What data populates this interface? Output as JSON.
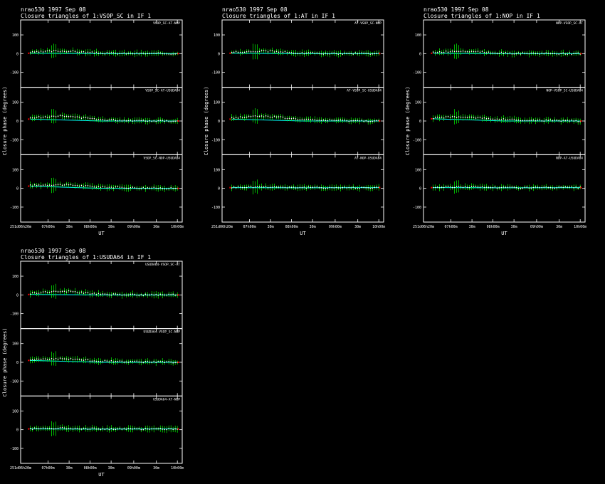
{
  "ylabel": "Closure phase (degrees)",
  "xlabel": "UT",
  "colors": {
    "model": "#00ffff",
    "data": "#00ff00",
    "errbar": "#ffffff",
    "flag": "#ff0000",
    "frame": "#ffffff",
    "bg": "#000000"
  },
  "x_ticks": [
    "251d06h20m",
    "07h00m",
    "30m",
    "08h00m",
    "30m",
    "09h00m",
    "30m",
    "10h00m"
  ],
  "y_ticks": [
    "100",
    "0",
    "-100"
  ],
  "chart_data": [
    {
      "type": "scatter",
      "title_line1": "nrao530   1997 Sep 08",
      "title_line2": "Closure triangles of 1:VSOP_SC in IF 1",
      "xlabel": "UT",
      "ylabel": "Closure phase (degrees)",
      "xlim_hours": [
        6.33,
        10.0
      ],
      "ylim": [
        -180,
        180
      ],
      "panels": [
        {
          "label": "VSOP_SC-AT-NOP",
          "offset": [
            2,
            0,
            0
          ],
          "bump": 12
        },
        {
          "label": "VSOP_SC-AT-USUDA64",
          "offset": [
            10,
            0,
            0
          ],
          "bump": 18
        },
        {
          "label": "VSOP_SC-NOP-USUDA64",
          "offset": [
            12,
            0,
            0
          ],
          "bump": 10
        }
      ]
    },
    {
      "type": "scatter",
      "title_line1": "nrao530   1997 Sep 08",
      "title_line2": "Closure triangles of 1:AT in IF 1",
      "xlabel": "UT",
      "ylabel": "Closure phase (degrees)",
      "xlim_hours": [
        6.33,
        10.0
      ],
      "ylim": [
        -180,
        180
      ],
      "panels": [
        {
          "label": "AT-VSOP_SC-NOP",
          "offset": [
            2,
            0,
            0
          ],
          "bump": 12
        },
        {
          "label": "AT-VSOP_SC-USUDA64",
          "offset": [
            10,
            0,
            0
          ],
          "bump": 18
        },
        {
          "label": "AT-NOP-USUDA64",
          "offset": [
            4,
            3,
            4
          ],
          "bump": 4
        }
      ]
    },
    {
      "type": "scatter",
      "title_line1": "nrao530   1997 Sep 08",
      "title_line2": "Closure triangles of 1:NOP in IF 1",
      "xlabel": "UT",
      "ylabel": "Closure phase (degrees)",
      "xlim_hours": [
        6.33,
        10.0
      ],
      "ylim": [
        -180,
        180
      ],
      "panels": [
        {
          "label": "NOP-VSOP_SC-AT",
          "offset": [
            2,
            0,
            0
          ],
          "bump": 12
        },
        {
          "label": "NOP-VSOP_SC-USUDA64",
          "offset": [
            12,
            0,
            0
          ],
          "bump": 12
        },
        {
          "label": "NOP-AT-USUDA64",
          "offset": [
            4,
            3,
            4
          ],
          "bump": 4
        }
      ]
    },
    {
      "type": "scatter",
      "title_line1": "nrao530   1997 Sep 08",
      "title_line2": "Closure triangles of 1:USUDA64 in IF 1",
      "xlabel": "UT",
      "ylabel": "Closure phase (degrees)",
      "xlim_hours": [
        6.33,
        10.0
      ],
      "ylim": [
        -180,
        180
      ],
      "panels": [
        {
          "label": "USUDA64-VSOP_SC-AT",
          "offset": [
            2,
            0,
            0
          ],
          "bump": 18
        },
        {
          "label": "USUDA64-VSOP_SC-NOP",
          "offset": [
            10,
            0,
            0
          ],
          "bump": 10
        },
        {
          "label": "USUDA64-AT-NOP",
          "offset": [
            4,
            3,
            4
          ],
          "bump": 4
        }
      ]
    }
  ]
}
